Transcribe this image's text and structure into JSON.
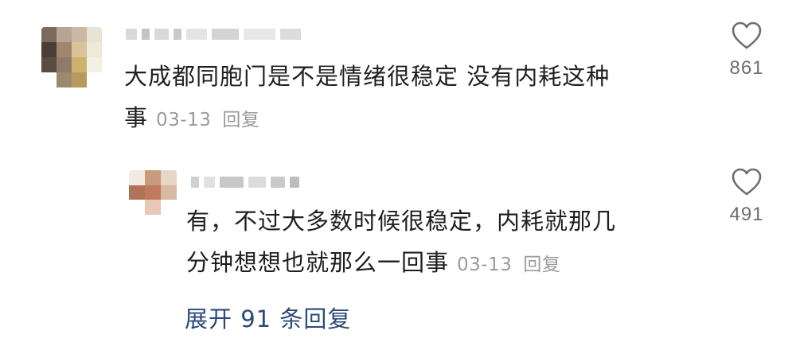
{
  "comments": [
    {
      "text_line1": "大成都同胞门是不是情绪很稳定 没有内耗这种",
      "text_line2": "事",
      "date": "03-13",
      "reply_label": "回复",
      "like_count": "861",
      "like_icon": "heart-outline-icon"
    }
  ],
  "reply": {
    "text_line1": "有，不过大多数时候很稳定，内耗就那几",
    "text_line2": "分钟想想也就那么一回事",
    "date": "03-13",
    "reply_label": "回复",
    "like_count": "491",
    "like_icon": "heart-outline-icon"
  },
  "expand": {
    "label": "展开 91 条回复"
  },
  "colors": {
    "text": "#1f1f1f",
    "meta": "#9a9a9a",
    "link": "#2b4a78",
    "icon": "#6e6e6e"
  }
}
